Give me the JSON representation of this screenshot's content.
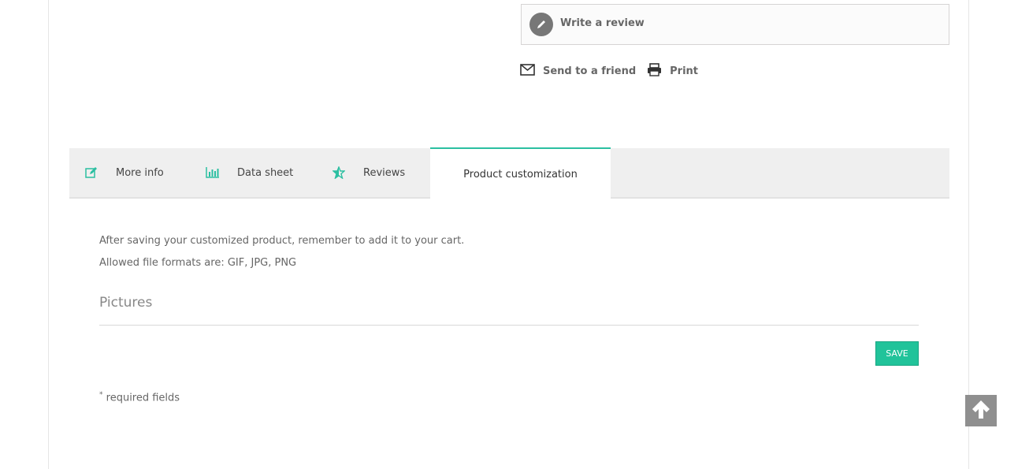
{
  "review": {
    "label": "Write a review",
    "icon": "pencil-icon"
  },
  "social": {
    "send_label": "Send to a friend",
    "send_icon": "envelope-icon",
    "print_label": "Print",
    "print_icon": "printer-icon"
  },
  "tabs": [
    {
      "label": "More info",
      "icon": "edit-icon"
    },
    {
      "label": "Data sheet",
      "icon": "bar-chart-icon"
    },
    {
      "label": "Reviews",
      "icon": "star-icon"
    },
    {
      "label": "Product customization",
      "active": true
    }
  ],
  "customization": {
    "note": "After saving your customized product, remember to add it to your cart.",
    "formats": "Allowed file formats are: GIF, JPG, PNG",
    "section_title": "Pictures",
    "save_label": "SAVE",
    "required_mark": "*",
    "required_label": "required fields"
  },
  "colors": {
    "accent": "#2bbfa1",
    "button": "#21c39a",
    "back_to_top": "#8f8f8f"
  }
}
